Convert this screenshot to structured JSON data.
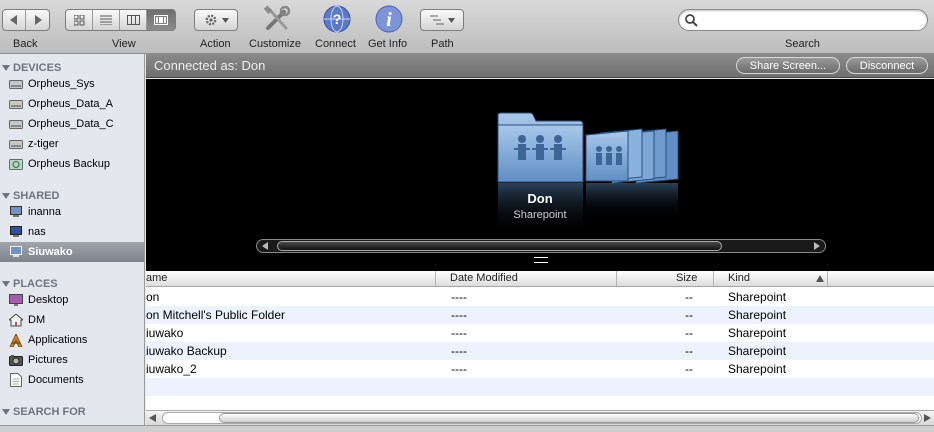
{
  "toolbar": {
    "back_label": "Back",
    "view_label": "View",
    "action_label": "Action",
    "customize_label": "Customize",
    "connect_label": "Connect",
    "getinfo_label": "Get Info",
    "path_label": "Path",
    "search_label": "Search",
    "search_placeholder": "",
    "icons": {
      "back": "chevron-left-icon",
      "forward": "chevron-right-icon",
      "action": "gear-icon",
      "customize": "tools-icon",
      "connect": "connect-globe-icon",
      "getinfo": "info-icon",
      "path": "path-menu-icon",
      "search": "search-icon"
    }
  },
  "sidebar": {
    "devices_title": "DEVICES",
    "devices": [
      {
        "label": "Orpheus_Sys",
        "icon": "hard-drive-icon"
      },
      {
        "label": "Orpheus_Data_A",
        "icon": "hard-drive-icon"
      },
      {
        "label": "Orpheus_Data_C",
        "icon": "hard-drive-icon"
      },
      {
        "label": "z-tiger",
        "icon": "hard-drive-icon"
      },
      {
        "label": "Orpheus Backup",
        "icon": "time-machine-disk-icon"
      }
    ],
    "shared_title": "SHARED",
    "shared": [
      {
        "label": "inanna",
        "icon": "network-computer-icon"
      },
      {
        "label": "nas",
        "icon": "network-computer-icon"
      },
      {
        "label": "Siuwako",
        "icon": "network-computer-icon",
        "selected": true
      }
    ],
    "places_title": "PLACES",
    "places": [
      {
        "label": "Desktop",
        "icon": "desktop-icon"
      },
      {
        "label": "DM",
        "icon": "home-icon"
      },
      {
        "label": "Applications",
        "icon": "applications-icon"
      },
      {
        "label": "Pictures",
        "icon": "pictures-icon"
      },
      {
        "label": "Documents",
        "icon": "documents-icon"
      }
    ],
    "search_title": "SEARCH FOR"
  },
  "connbar": {
    "text": "Connected as: Don",
    "share_screen": "Share Screen...",
    "disconnect": "Disconnect"
  },
  "coverflow": {
    "title": "Don",
    "subtitle": "Sharepoint"
  },
  "list": {
    "columns": {
      "name": "ame",
      "date": "Date Modified",
      "size": "Size",
      "kind": "Kind"
    },
    "rows": [
      {
        "name": "on",
        "date": "----",
        "size": "--",
        "kind": "Sharepoint"
      },
      {
        "name": "on Mitchell's Public Folder",
        "date": "----",
        "size": "--",
        "kind": "Sharepoint"
      },
      {
        "name": "iuwako",
        "date": "----",
        "size": "--",
        "kind": "Sharepoint"
      },
      {
        "name": "iuwako Backup",
        "date": "----",
        "size": "--",
        "kind": "Sharepoint"
      },
      {
        "name": "iuwako_2",
        "date": "----",
        "size": "--",
        "kind": "Sharepoint"
      }
    ]
  },
  "colors": {
    "selection": "#7f848c",
    "alt_row": "#edf3fe",
    "folder_blue": "#7fa9d6"
  }
}
